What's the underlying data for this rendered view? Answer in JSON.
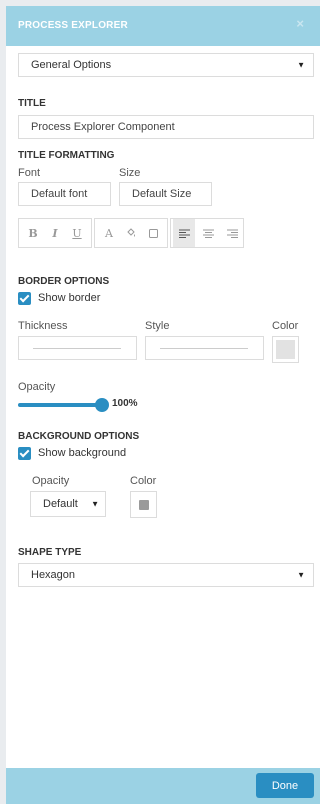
{
  "header": {
    "title": "PROCESS EXPLORER",
    "close_glyph": "×"
  },
  "options_select": {
    "value": "General Options",
    "arrow": "▼"
  },
  "title_section": {
    "label": "TITLE",
    "value": "Process Explorer Component"
  },
  "title_formatting": {
    "label": "TITLE FORMATTING",
    "font_label": "Font",
    "font_value": "Default font",
    "size_label": "Size",
    "size_value": "Default Size",
    "toolbar": {
      "bold": "B",
      "italic": "I",
      "underline": "U",
      "font_color": "A",
      "fill_icon": "paint-bucket-icon",
      "border_icon": "square-outline-icon",
      "align_left_icon": "align-left-icon",
      "align_center_icon": "align-center-icon",
      "align_right_icon": "align-right-icon"
    }
  },
  "border_options": {
    "label": "BORDER OPTIONS",
    "show_border_label": "Show border",
    "show_border_checked": true,
    "thickness_label": "Thickness",
    "style_label": "Style",
    "color_label": "Color",
    "swatch_color": "#e2e2e2",
    "opacity_label": "Opacity",
    "opacity_value": "100%",
    "opacity_fraction": 1.0
  },
  "background_options": {
    "label": "BACKGROUND OPTIONS",
    "show_background_label": "Show background",
    "show_background_checked": true,
    "opacity_label": "Opacity",
    "opacity_value": "Default",
    "color_label": "Color",
    "swatch_color": "#9a9a9a"
  },
  "shape_type": {
    "label": "SHAPE TYPE",
    "value": "Hexagon",
    "arrow": "▼"
  },
  "footer": {
    "done_label": "Done"
  },
  "colors": {
    "header_bg": "#9bd2e4",
    "accent": "#2a8ec2"
  }
}
